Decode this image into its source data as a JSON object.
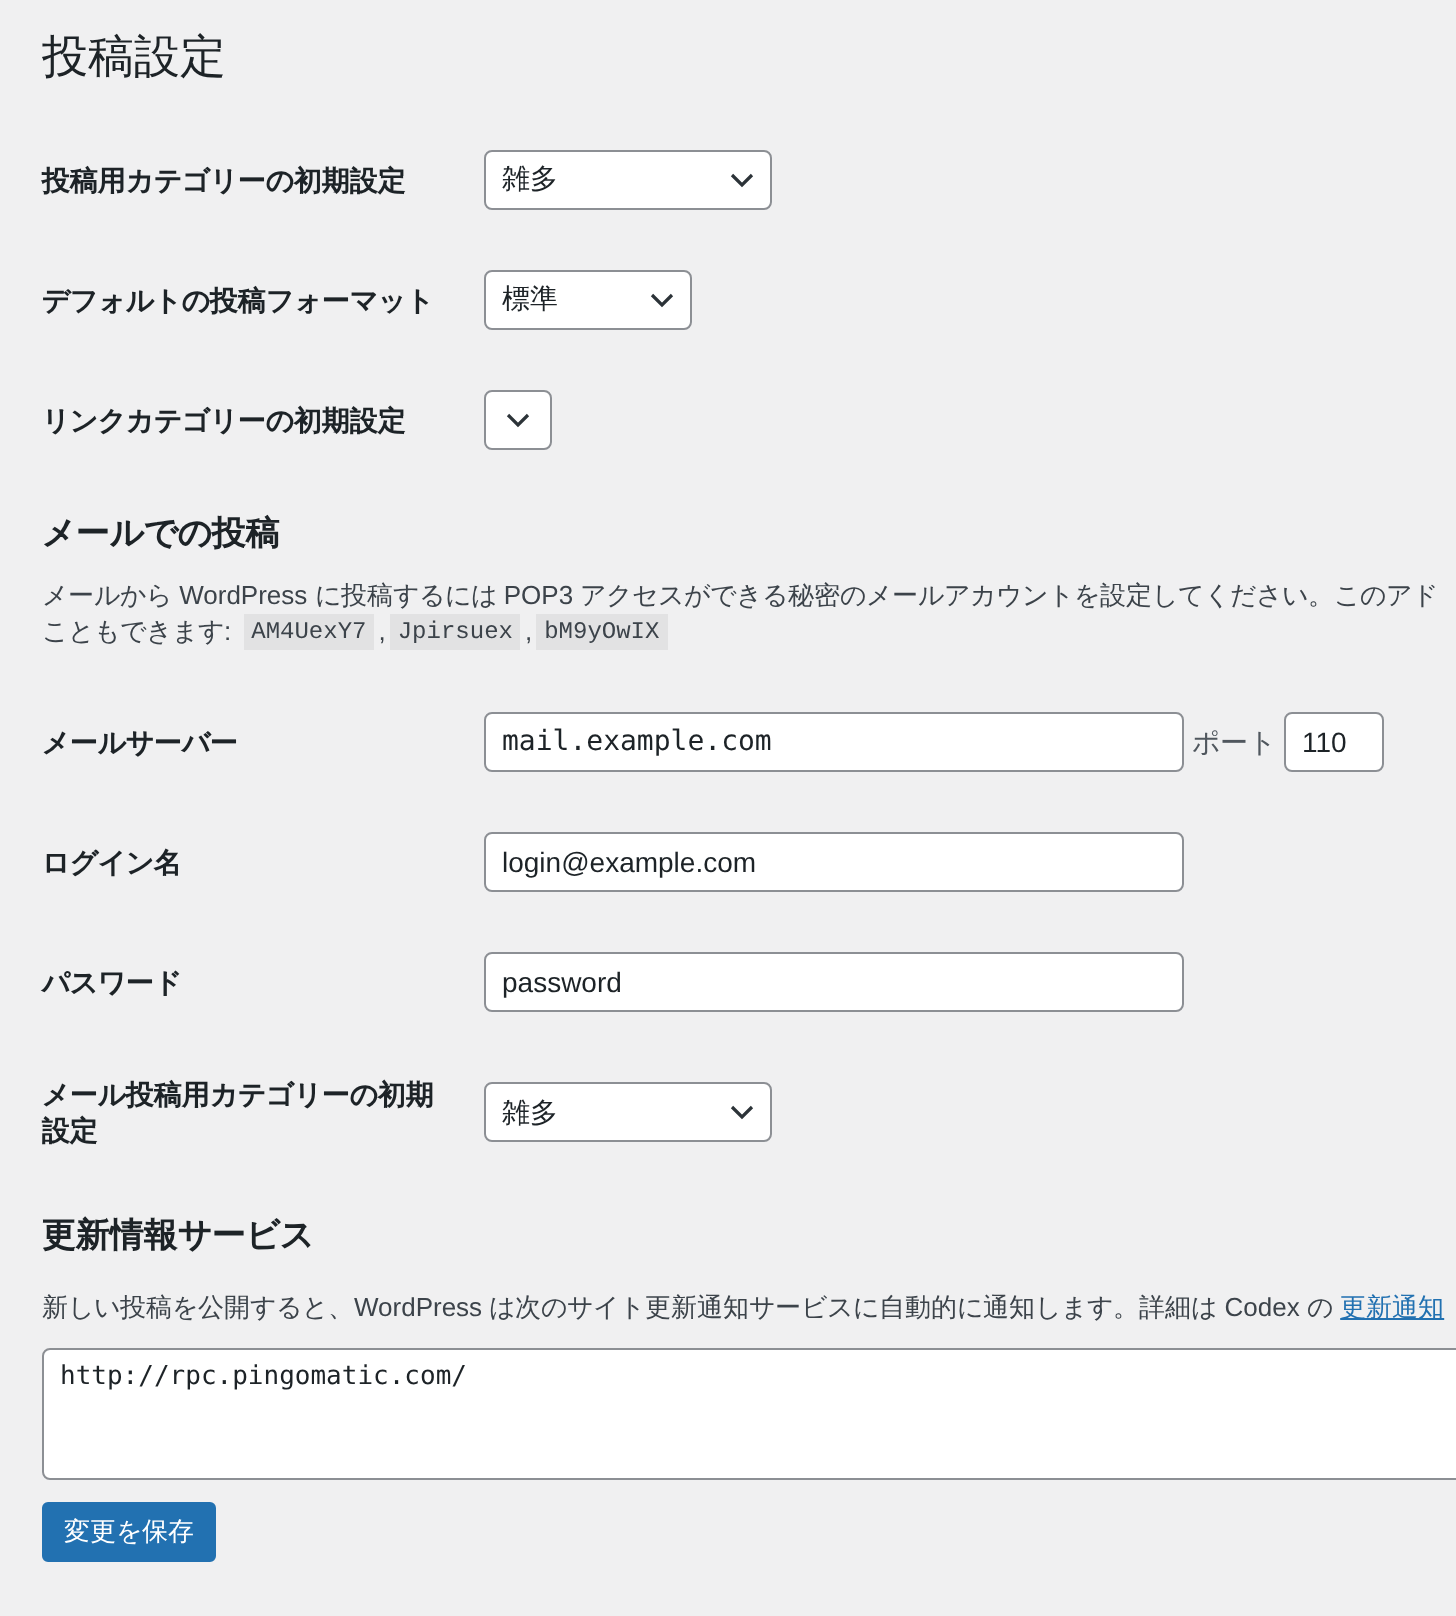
{
  "page_title": "投稿設定",
  "settings": [
    {
      "label": "投稿用カテゴリーの初期設定",
      "kind": "select",
      "value": "雑多"
    },
    {
      "label": "デフォルトの投稿フォーマット",
      "kind": "select",
      "value": "標準"
    },
    {
      "label": "リンクカテゴリーの初期設定",
      "kind": "select"
    }
  ],
  "post_via_email": {
    "heading": "メールでの投稿",
    "description": "メールから WordPress に投稿するには POP3 アクセスができる秘密のメールアカウントを設定してください。このアド",
    "description_line2": "こともできます:",
    "codes": [
      "AM4UexY7",
      "Jpirsuex",
      "bM9yOwIX"
    ],
    "code_separator": ",",
    "fields": [
      {
        "label": "メールサーバー",
        "kind": "mono",
        "value": "mail.example.com",
        "port_label": "ポート",
        "port_value": "110"
      },
      {
        "label": "ログイン名",
        "kind": "text",
        "value": "login@example.com"
      },
      {
        "label": "パスワード",
        "kind": "text",
        "value": "password"
      },
      {
        "label": "メール投稿用カテゴリーの初期設定",
        "kind": "select",
        "value": "雑多"
      }
    ]
  },
  "update_services": {
    "heading": "更新情報サービス",
    "description": "新しい投稿を公開すると、WordPress は次のサイト更新通知サービスに自動的に通知します。詳細は Codex の",
    "link": "更新通知",
    "textarea": "http://rpc.pingomatic.com/"
  },
  "save_button": "変更を保存"
}
